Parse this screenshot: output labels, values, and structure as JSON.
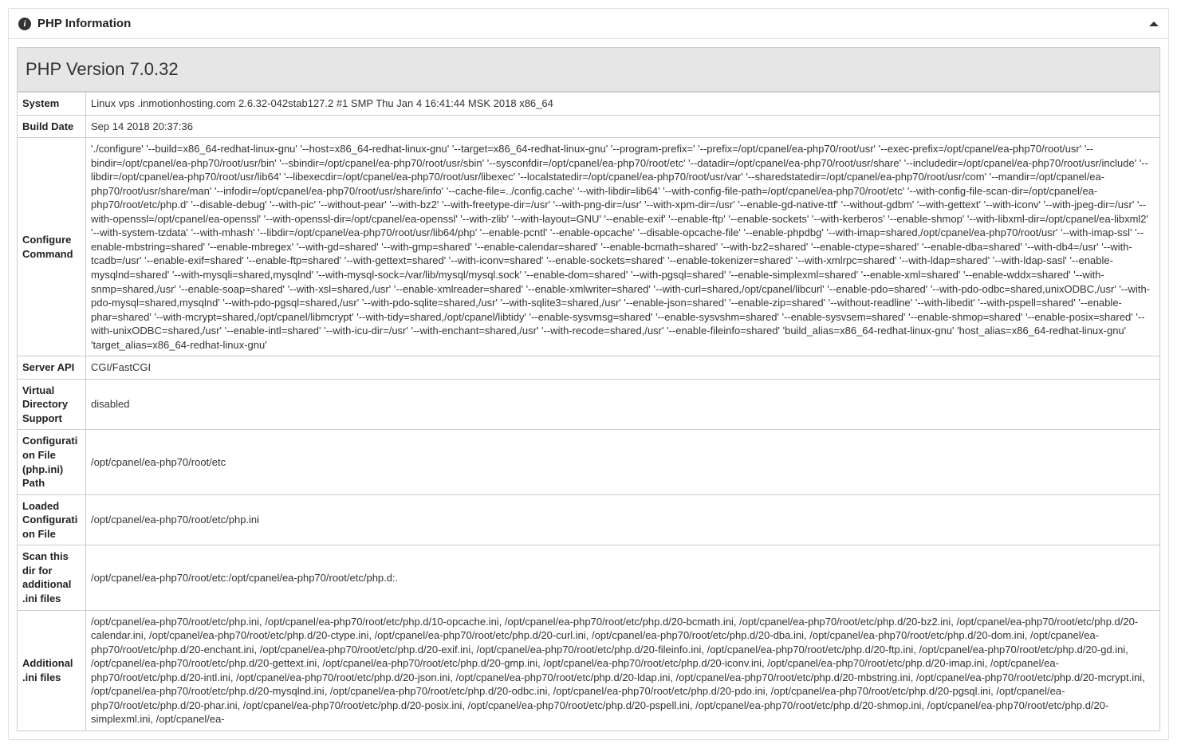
{
  "header": {
    "title": "PHP Information"
  },
  "version": "PHP Version 7.0.32",
  "rows": [
    {
      "label": "System",
      "value": "Linux vps       .inmotionhosting.com 2.6.32-042stab127.2 #1 SMP Thu Jan 4 16:41:44 MSK 2018 x86_64"
    },
    {
      "label": "Build Date",
      "value": "Sep 14 2018 20:37:36"
    },
    {
      "label": "Configure Command",
      "value": "'./configure' '--build=x86_64-redhat-linux-gnu' '--host=x86_64-redhat-linux-gnu' '--target=x86_64-redhat-linux-gnu' '--program-prefix=' '--prefix=/opt/cpanel/ea-php70/root/usr' '--exec-prefix=/opt/cpanel/ea-php70/root/usr' '--bindir=/opt/cpanel/ea-php70/root/usr/bin' '--sbindir=/opt/cpanel/ea-php70/root/usr/sbin' '--sysconfdir=/opt/cpanel/ea-php70/root/etc' '--datadir=/opt/cpanel/ea-php70/root/usr/share' '--includedir=/opt/cpanel/ea-php70/root/usr/include' '--libdir=/opt/cpanel/ea-php70/root/usr/lib64' '--libexecdir=/opt/cpanel/ea-php70/root/usr/libexec' '--localstatedir=/opt/cpanel/ea-php70/root/usr/var' '--sharedstatedir=/opt/cpanel/ea-php70/root/usr/com' '--mandir=/opt/cpanel/ea-php70/root/usr/share/man' '--infodir=/opt/cpanel/ea-php70/root/usr/share/info' '--cache-file=../config.cache' '--with-libdir=lib64' '--with-config-file-path=/opt/cpanel/ea-php70/root/etc' '--with-config-file-scan-dir=/opt/cpanel/ea-php70/root/etc/php.d' '--disable-debug' '--with-pic' '--without-pear' '--with-bz2' '--with-freetype-dir=/usr' '--with-png-dir=/usr' '--with-xpm-dir=/usr' '--enable-gd-native-ttf' '--without-gdbm' '--with-gettext' '--with-iconv' '--with-jpeg-dir=/usr' '--with-openssl=/opt/cpanel/ea-openssl' '--with-openssl-dir=/opt/cpanel/ea-openssl' '--with-zlib' '--with-layout=GNU' '--enable-exif' '--enable-ftp' '--enable-sockets' '--with-kerberos' '--enable-shmop' '--with-libxml-dir=/opt/cpanel/ea-libxml2' '--with-system-tzdata' '--with-mhash' '--libdir=/opt/cpanel/ea-php70/root/usr/lib64/php' '--enable-pcntl' '--enable-opcache' '--disable-opcache-file' '--enable-phpdbg' '--with-imap=shared,/opt/cpanel/ea-php70/root/usr' '--with-imap-ssl' '--enable-mbstring=shared' '--enable-mbregex' '--with-gd=shared' '--with-gmp=shared' '--enable-calendar=shared' '--enable-bcmath=shared' '--with-bz2=shared' '--enable-ctype=shared' '--enable-dba=shared' '--with-db4=/usr' '--with-tcadb=/usr' '--enable-exif=shared' '--enable-ftp=shared' '--with-gettext=shared' '--with-iconv=shared' '--enable-sockets=shared' '--enable-tokenizer=shared' '--with-xmlrpc=shared' '--with-ldap=shared' '--with-ldap-sasl' '--enable-mysqlnd=shared' '--with-mysqli=shared,mysqlnd' '--with-mysql-sock=/var/lib/mysql/mysql.sock' '--enable-dom=shared' '--with-pgsql=shared' '--enable-simplexml=shared' '--enable-xml=shared' '--enable-wddx=shared' '--with-snmp=shared,/usr' '--enable-soap=shared' '--with-xsl=shared,/usr' '--enable-xmlreader=shared' '--enable-xmlwriter=shared' '--with-curl=shared,/opt/cpanel/libcurl' '--enable-pdo=shared' '--with-pdo-odbc=shared,unixODBC,/usr' '--with-pdo-mysql=shared,mysqlnd' '--with-pdo-pgsql=shared,/usr' '--with-pdo-sqlite=shared,/usr' '--with-sqlite3=shared,/usr' '--enable-json=shared' '--enable-zip=shared' '--without-readline' '--with-libedit' '--with-pspell=shared' '--enable-phar=shared' '--with-mcrypt=shared,/opt/cpanel/libmcrypt' '--with-tidy=shared,/opt/cpanel/libtidy' '--enable-sysvmsg=shared' '--enable-sysvshm=shared' '--enable-sysvsem=shared' '--enable-shmop=shared' '--enable-posix=shared' '--with-unixODBC=shared,/usr' '--enable-intl=shared' '--with-icu-dir=/usr' '--with-enchant=shared,/usr' '--with-recode=shared,/usr' '--enable-fileinfo=shared' 'build_alias=x86_64-redhat-linux-gnu' 'host_alias=x86_64-redhat-linux-gnu' 'target_alias=x86_64-redhat-linux-gnu'"
    },
    {
      "label": "Server API",
      "value": "CGI/FastCGI"
    },
    {
      "label": "Virtual Directory Support",
      "value": "disabled"
    },
    {
      "label": "Configuration File (php.ini) Path",
      "value": "/opt/cpanel/ea-php70/root/etc"
    },
    {
      "label": "Loaded Configuration File",
      "value": "/opt/cpanel/ea-php70/root/etc/php.ini"
    },
    {
      "label": "Scan this dir for additional .ini files",
      "value": "/opt/cpanel/ea-php70/root/etc:/opt/cpanel/ea-php70/root/etc/php.d:."
    },
    {
      "label": "Additional .ini files",
      "value": "/opt/cpanel/ea-php70/root/etc/php.ini, /opt/cpanel/ea-php70/root/etc/php.d/10-opcache.ini, /opt/cpanel/ea-php70/root/etc/php.d/20-bcmath.ini, /opt/cpanel/ea-php70/root/etc/php.d/20-bz2.ini, /opt/cpanel/ea-php70/root/etc/php.d/20-calendar.ini, /opt/cpanel/ea-php70/root/etc/php.d/20-ctype.ini, /opt/cpanel/ea-php70/root/etc/php.d/20-curl.ini, /opt/cpanel/ea-php70/root/etc/php.d/20-dba.ini, /opt/cpanel/ea-php70/root/etc/php.d/20-dom.ini, /opt/cpanel/ea-php70/root/etc/php.d/20-enchant.ini, /opt/cpanel/ea-php70/root/etc/php.d/20-exif.ini, /opt/cpanel/ea-php70/root/etc/php.d/20-fileinfo.ini, /opt/cpanel/ea-php70/root/etc/php.d/20-ftp.ini, /opt/cpanel/ea-php70/root/etc/php.d/20-gd.ini, /opt/cpanel/ea-php70/root/etc/php.d/20-gettext.ini, /opt/cpanel/ea-php70/root/etc/php.d/20-gmp.ini, /opt/cpanel/ea-php70/root/etc/php.d/20-iconv.ini, /opt/cpanel/ea-php70/root/etc/php.d/20-imap.ini, /opt/cpanel/ea-php70/root/etc/php.d/20-intl.ini, /opt/cpanel/ea-php70/root/etc/php.d/20-json.ini, /opt/cpanel/ea-php70/root/etc/php.d/20-ldap.ini, /opt/cpanel/ea-php70/root/etc/php.d/20-mbstring.ini, /opt/cpanel/ea-php70/root/etc/php.d/20-mcrypt.ini, /opt/cpanel/ea-php70/root/etc/php.d/20-mysqlnd.ini, /opt/cpanel/ea-php70/root/etc/php.d/20-odbc.ini, /opt/cpanel/ea-php70/root/etc/php.d/20-pdo.ini, /opt/cpanel/ea-php70/root/etc/php.d/20-pgsql.ini, /opt/cpanel/ea-php70/root/etc/php.d/20-phar.ini, /opt/cpanel/ea-php70/root/etc/php.d/20-posix.ini, /opt/cpanel/ea-php70/root/etc/php.d/20-pspell.ini, /opt/cpanel/ea-php70/root/etc/php.d/20-shmop.ini, /opt/cpanel/ea-php70/root/etc/php.d/20-simplexml.ini, /opt/cpanel/ea-"
    }
  ]
}
